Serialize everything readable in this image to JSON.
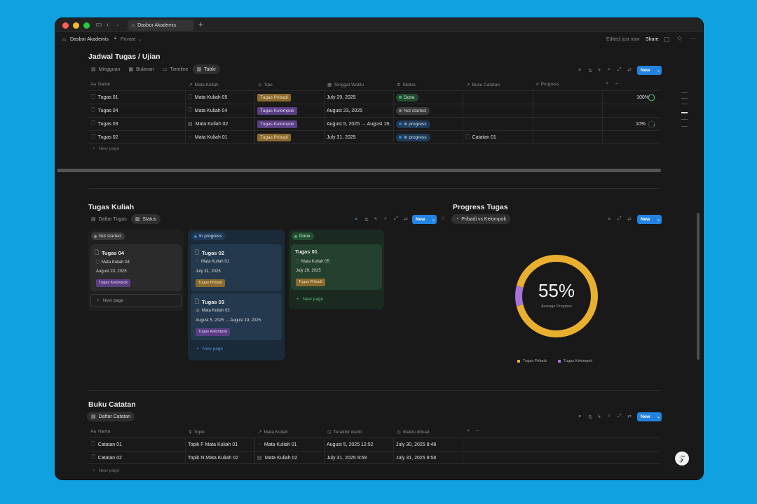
{
  "browser": {
    "tab_title": "Dasbor Akademis",
    "colors": {
      "close": "#fe5f57",
      "minimize": "#febc2e",
      "maximize": "#28c840"
    }
  },
  "topbar": {
    "workspace": "Dasbor Akademis",
    "privacy": "Private",
    "edited": "Edited just now",
    "share": "Share"
  },
  "jadwal": {
    "title": "Jadwal Tugas / Ujian",
    "views": [
      "Mingguan",
      "Bulanan",
      "Timeline",
      "Table"
    ],
    "new_label": "New",
    "columns": [
      "Name",
      "Mata Kuliah",
      "Tipe",
      "Tenggat Waktu",
      "Status",
      "Buku Catatan",
      "Progress"
    ],
    "rows": [
      {
        "name": "Tugas 01",
        "matkul": "Mata Kuliah 05",
        "tipe": "Tugas Pribadi",
        "tenggat": "July 29, 2025",
        "status": "Done",
        "buku": "",
        "progress": "100%",
        "progress_value": 1.0
      },
      {
        "name": "Tugas 04",
        "matkul": "Mata Kuliah 04",
        "tipe": "Tugas Kelompok",
        "tenggat": "August 23, 2025",
        "status": "Not started",
        "buku": "",
        "progress": "",
        "progress_value": 0
      },
      {
        "name": "Tugas 03",
        "matkul": "Mata Kuliah 02",
        "tipe": "Tugas Kelompok",
        "tenggat": "August 5, 2025 → August 19,",
        "status": "In progress",
        "buku": "",
        "progress": "10%",
        "progress_value": 0.1
      },
      {
        "name": "Tugas 02",
        "matkul": "Mata Kuliah 01",
        "tipe": "Tugas Pribadi",
        "tenggat": "July 31, 2025",
        "status": "In progress",
        "buku": "Catatan 01",
        "progress": "",
        "progress_value": 0
      }
    ],
    "new_page": "New page"
  },
  "kuliah": {
    "title": "Tugas Kuliah",
    "views": [
      "Daftar Tugas",
      "Status"
    ],
    "new_label": "New",
    "groups": [
      {
        "label": "Not started",
        "cards": [
          {
            "title": "Tugas 04",
            "matkul": "Mata Kuliah 04",
            "date": "August 23, 2025",
            "tipe": "Tugas Kelompok"
          }
        ],
        "new_page": "New page"
      },
      {
        "label": "In progress",
        "cards": [
          {
            "title": "Tugas 02",
            "matkul": "Mata Kuliah 01",
            "date": "July 31, 2025",
            "tipe": "Tugas Pribadi"
          },
          {
            "title": "Tugas 03",
            "matkul": "Mata Kuliah 02",
            "date": "August 5, 2025 → August 19, 2025",
            "tipe": "Tugas Kelompok"
          }
        ],
        "new_page": "New page"
      },
      {
        "label": "Done",
        "cards": [
          {
            "title": "Tugas 01",
            "matkul": "Mata Kuliah 05",
            "date": "July 29, 2025",
            "tipe": "Tugas Pribadi"
          }
        ],
        "new_page": "New page"
      }
    ]
  },
  "progress": {
    "title": "Progress Tugas",
    "view": "Pribadi vs Kelompok",
    "new_label": "New"
  },
  "chart_data": {
    "type": "pie",
    "center_value": "55%",
    "center_label": "Average Progress",
    "series": [
      {
        "name": "Tugas Pribadi",
        "value": 92,
        "color": "#e9b030"
      },
      {
        "name": "Tugas Kelompok",
        "value": 8,
        "color": "#a673d9"
      }
    ],
    "legend": "bottom"
  },
  "buku": {
    "title": "Buku Catatan",
    "view": "Daftar Catatan",
    "new_label": "New",
    "columns": [
      "Nama",
      "Topik",
      "Mata Kuliah",
      "Terakhir diedit",
      "Waktu dibuat"
    ],
    "rows": [
      {
        "nama": "Catatan 01",
        "topik": "Topik F Mata Kuliah 01",
        "matkul": "Mata Kuliah 01",
        "edit": "August 5, 2025 12:52",
        "dibuat": "July 30, 2025 8:48"
      },
      {
        "nama": "Catatan 02",
        "topik": "Topik N Mata Kuliah 02",
        "matkul": "Mata Kuliah 02",
        "edit": "July 31, 2025 9:59",
        "dibuat": "July 31, 2025 9:58"
      }
    ],
    "new_page": "New page"
  }
}
